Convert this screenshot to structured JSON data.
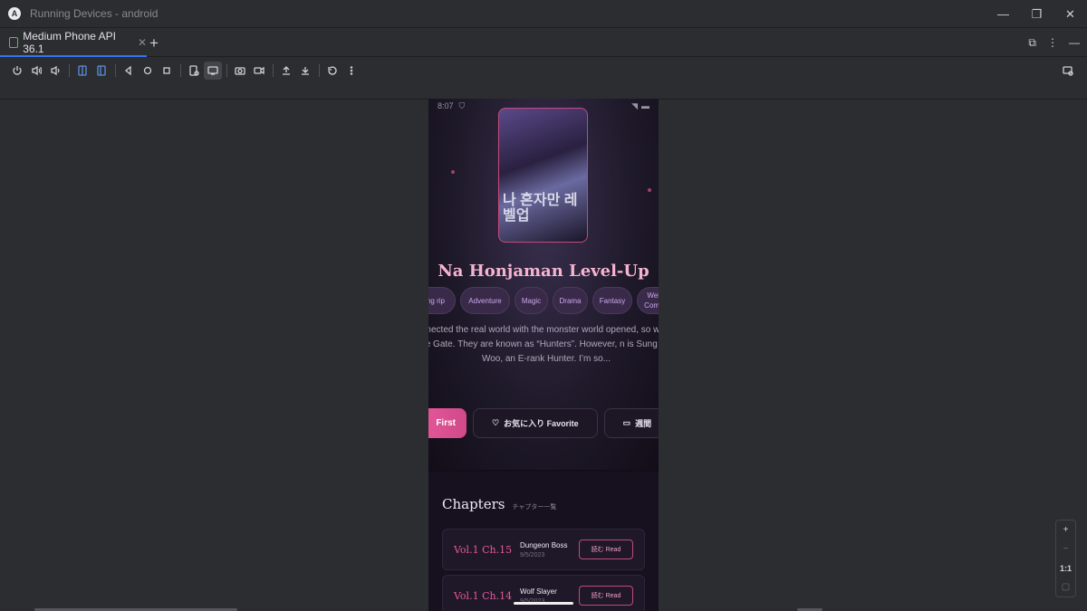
{
  "window": {
    "title": "Running Devices - android",
    "app_logo": "A"
  },
  "tabs": [
    {
      "label": "Medium Phone API 36.1"
    }
  ],
  "device": {
    "status": {
      "time": "8:07"
    },
    "manga": {
      "title": "Na Honjaman Level-Up",
      "cover_text": "나 혼자만 레벨업",
      "genres": [
        "ng rip",
        "Adventure",
        "Magic",
        "Drama",
        "Fantasy",
        "Web Comic"
      ],
      "description": "onnected the real world with the monster world opened, so within the Gate. They are known as “Hunters”. However, n is Sung Jin-Woo, an E-rank Hunter. I’m so..."
    },
    "actions": {
      "read_first": "First",
      "favorite": "お気に入り Favorite",
      "weekly": "週間"
    },
    "chapters": {
      "title": "Chapters",
      "subtitle": "チャプター一覧",
      "items": [
        {
          "number": "Vol.1 Ch.15",
          "name": "Dungeon Boss",
          "date": "9/5/2023",
          "read_label": "読む Read"
        },
        {
          "number": "Vol.1 Ch.14",
          "name": "Wolf Slayer",
          "date": "9/5/2023",
          "read_label": "読む Read"
        }
      ]
    }
  },
  "zoom": {
    "plus": "+",
    "minus": "−",
    "actual": "1:1"
  },
  "colors": {
    "accent": "#e85a9a",
    "tab_underline": "#3574f0",
    "title_pink": "#f5b3cf"
  }
}
